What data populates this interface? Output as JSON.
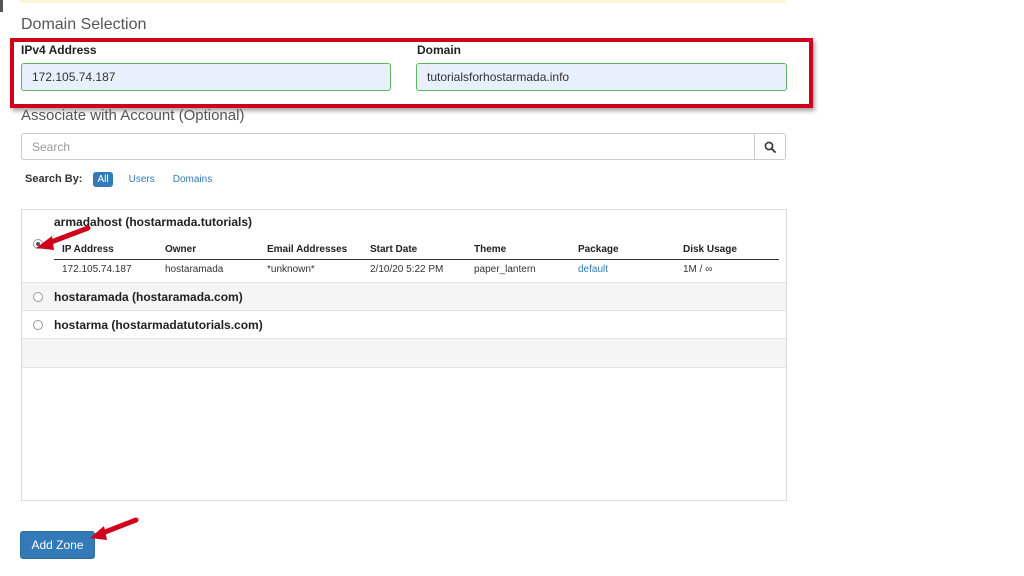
{
  "form": {
    "section_title": "Domain Selection",
    "ipv4": {
      "label": "IPv4 Address",
      "value": "172.105.74.187"
    },
    "domain": {
      "label": "Domain",
      "value": "tutorialsforhostarmada.info"
    }
  },
  "associate": {
    "title": "Associate with Account (Optional)",
    "search_placeholder": "Search",
    "search_by_label": "Search By:",
    "filters": {
      "all": "All",
      "users": "Users",
      "domains": "Domains"
    }
  },
  "accounts": [
    {
      "name": "armadahost (hostarmada.tutorials)",
      "selected": true
    },
    {
      "name": "hostaramada (hostaramada.com)",
      "selected": false
    },
    {
      "name": "hostarma (hostarmadatutorials.com)",
      "selected": false
    }
  ],
  "details_table": {
    "headers": {
      "ip": "IP Address",
      "owner": "Owner",
      "email": "Email Addresses",
      "start": "Start Date",
      "theme": "Theme",
      "package": "Package",
      "disk": "Disk Usage"
    },
    "row": {
      "ip": "172.105.74.187",
      "owner": "hostaramada",
      "email": "*unknown*",
      "start": "2/10/20 5:22 PM",
      "theme": "paper_lantern",
      "package": "default",
      "disk": "1M / ∞"
    }
  },
  "actions": {
    "add_zone": "Add Zone"
  },
  "icons": {
    "search": "search-icon",
    "arrow": "red-arrow-icon"
  },
  "colors": {
    "primary": "#337ab7",
    "highlight": "#d0021b",
    "input_border": "#5cb85c",
    "input_fill": "#e8f0fe"
  }
}
